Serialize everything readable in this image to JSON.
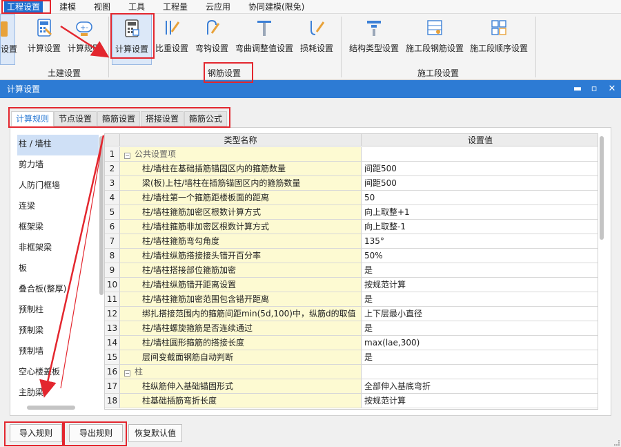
{
  "menubar": {
    "items": [
      "工程设置",
      "建模",
      "视图",
      "工具",
      "工程量",
      "云应用",
      "协同建模(限免)"
    ]
  },
  "ribbon": {
    "partial_label": "设置",
    "buttons": [
      "计算设置",
      "计算规则",
      "计算设置",
      "比重设置",
      "弯钩设置",
      "弯曲调整值设置",
      "损耗设置",
      "结构类型设置",
      "施工段钢筋设置",
      "施工段顺序设置"
    ],
    "groups": [
      "土建设置",
      "钢筋设置",
      "施工段设置"
    ]
  },
  "dialog": {
    "title": "计算设置",
    "tabs": [
      "计算规则",
      "节点设置",
      "箍筋设置",
      "搭接设置",
      "箍筋公式"
    ],
    "left_list": [
      "柱 / 墙柱",
      "剪力墙",
      "人防门框墙",
      "连梁",
      "框架梁",
      "非框架梁",
      "板",
      "叠合板(整厚)",
      "预制柱",
      "预制梁",
      "预制墙",
      "空心楼盖板",
      "主肋梁"
    ],
    "grid": {
      "headers": [
        "类型名称",
        "设置值"
      ],
      "rows": [
        {
          "num": "1",
          "name": "公共设置项",
          "value": "",
          "group": true
        },
        {
          "num": "2",
          "name": "柱/墙柱在基础插筋锚固区内的箍筋数量",
          "value": "间距500"
        },
        {
          "num": "3",
          "name": "梁(板)上柱/墙柱在插筋锚固区内的箍筋数量",
          "value": "间距500"
        },
        {
          "num": "4",
          "name": "柱/墙柱第一个箍筋距楼板面的距离",
          "value": "50"
        },
        {
          "num": "5",
          "name": "柱/墙柱箍筋加密区根数计算方式",
          "value": "向上取整+1"
        },
        {
          "num": "6",
          "name": "柱/墙柱箍筋非加密区根数计算方式",
          "value": "向上取整-1"
        },
        {
          "num": "7",
          "name": "柱/墙柱箍筋弯勾角度",
          "value": "135°"
        },
        {
          "num": "8",
          "name": "柱/墙柱纵筋搭接接头错开百分率",
          "value": "50%"
        },
        {
          "num": "9",
          "name": "柱/墙柱搭接部位箍筋加密",
          "value": "是"
        },
        {
          "num": "10",
          "name": "柱/墙柱纵筋错开距离设置",
          "value": "按规范计算"
        },
        {
          "num": "11",
          "name": "柱/墙柱箍筋加密范围包含错开距离",
          "value": "是"
        },
        {
          "num": "12",
          "name": "绑扎搭接范围内的箍筋间距min(5d,100)中，纵筋d的取值",
          "value": "上下层最小直径"
        },
        {
          "num": "13",
          "name": "柱/墙柱螺旋箍筋是否连续通过",
          "value": "是"
        },
        {
          "num": "14",
          "name": "柱/墙柱圆形箍筋的搭接长度",
          "value": "max(lae,300)"
        },
        {
          "num": "15",
          "name": "层间变截面钢筋自动判断",
          "value": "是"
        },
        {
          "num": "16",
          "name": "柱",
          "value": "",
          "group": true
        },
        {
          "num": "17",
          "name": "柱纵筋伸入基础锚固形式",
          "value": "全部伸入基底弯折"
        },
        {
          "num": "18",
          "name": "柱基础插筋弯折长度",
          "value": "按规范计算"
        }
      ]
    },
    "buttons": [
      "导入规则",
      "导出规则",
      "恢复默认值"
    ]
  },
  "colors": {
    "accent": "#2d7bd4",
    "highlight": "#e3262e",
    "name_cell": "#fdfad2"
  }
}
